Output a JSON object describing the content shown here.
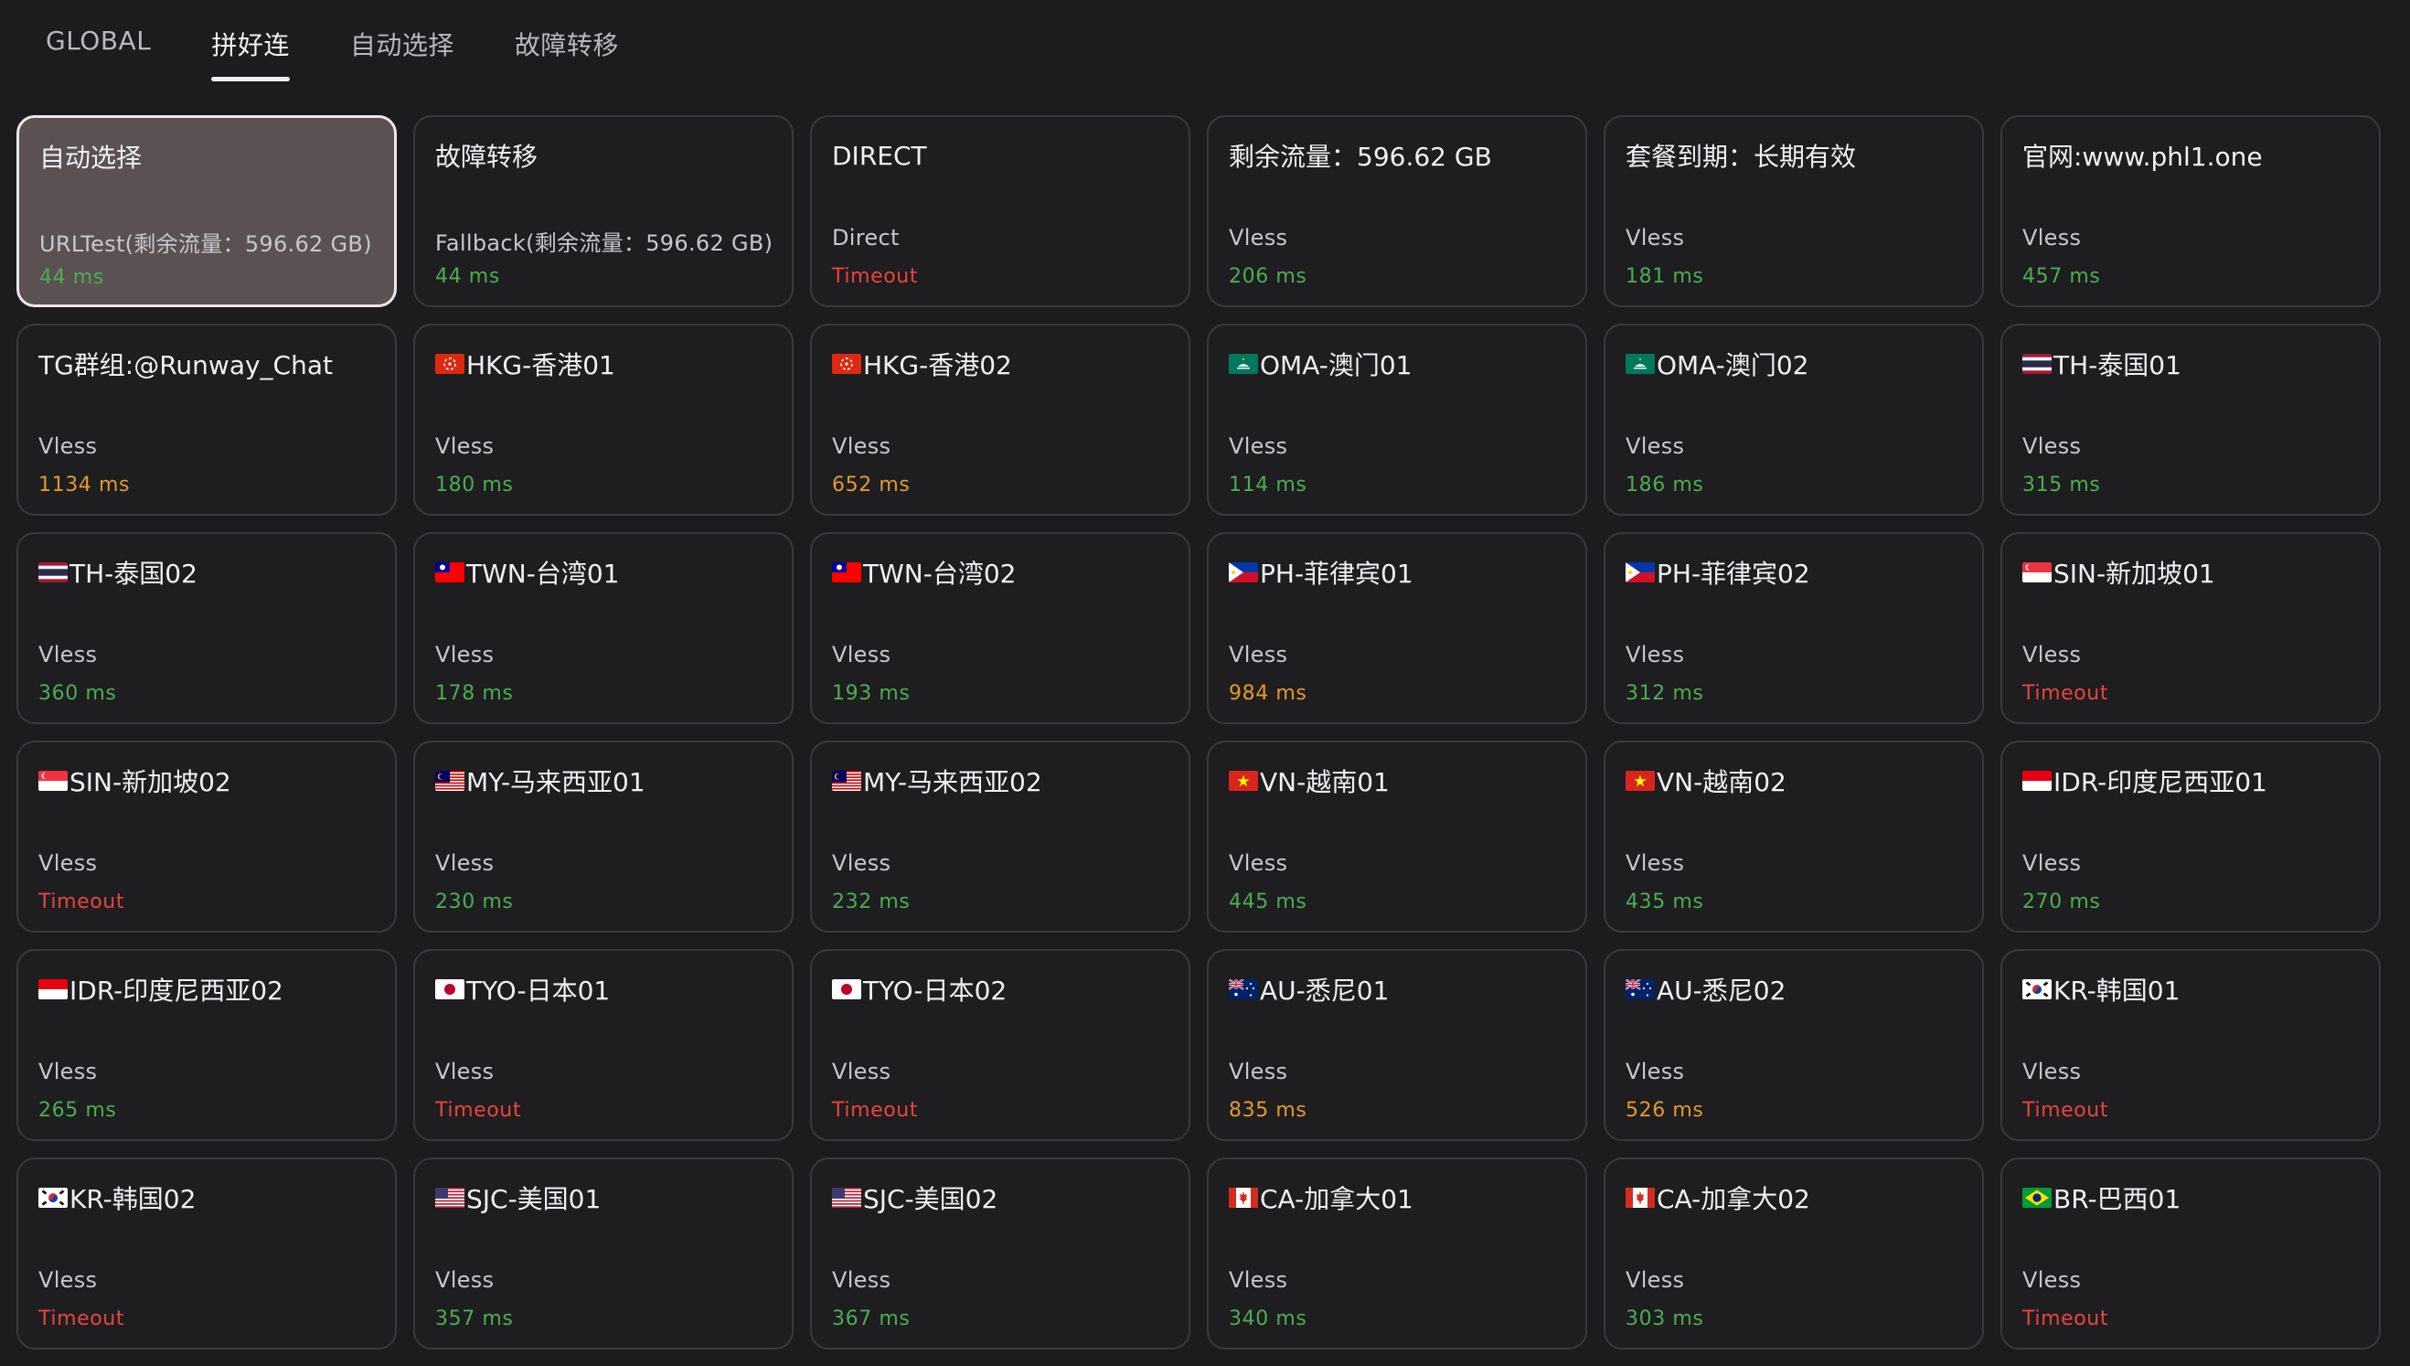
{
  "tabs": [
    {
      "label": "GLOBAL",
      "active": false
    },
    {
      "label": "拼好连",
      "active": true
    },
    {
      "label": "自动选择",
      "active": false
    },
    {
      "label": "故障转移",
      "active": false
    }
  ],
  "colors": {
    "good": "#4cae4f",
    "warn": "#e39a2b",
    "bad": "#e8453c"
  },
  "proxies": [
    {
      "name": "自动选择",
      "flag": "",
      "type": "URLTest(剩余流量：596.62 GB)",
      "delay": "44 ms",
      "status": "good",
      "selected": true
    },
    {
      "name": "故障转移",
      "flag": "",
      "type": "Fallback(剩余流量：596.62 GB)",
      "delay": "44 ms",
      "status": "good"
    },
    {
      "name": "DIRECT",
      "flag": "",
      "type": "Direct",
      "delay": "Timeout",
      "status": "bad"
    },
    {
      "name": "剩余流量：596.62 GB",
      "flag": "",
      "type": "Vless",
      "delay": "206 ms",
      "status": "good"
    },
    {
      "name": "套餐到期：长期有效",
      "flag": "",
      "type": "Vless",
      "delay": "181 ms",
      "status": "good"
    },
    {
      "name": "官网:www.phl1.one",
      "flag": "",
      "type": "Vless",
      "delay": "457 ms",
      "status": "good"
    },
    {
      "name": "TG群组:@Runway_Chat",
      "flag": "",
      "type": "Vless",
      "delay": "1134 ms",
      "status": "warn"
    },
    {
      "name": "HKG-香港01",
      "flag": "hk-flag-icon",
      "type": "Vless",
      "delay": "180 ms",
      "status": "good"
    },
    {
      "name": "HKG-香港02",
      "flag": "hk-flag-icon",
      "type": "Vless",
      "delay": "652 ms",
      "status": "warn"
    },
    {
      "name": "OMA-澳门01",
      "flag": "mo-flag-icon",
      "type": "Vless",
      "delay": "114 ms",
      "status": "good"
    },
    {
      "name": "OMA-澳门02",
      "flag": "mo-flag-icon",
      "type": "Vless",
      "delay": "186 ms",
      "status": "good"
    },
    {
      "name": "TH-泰国01",
      "flag": "th-flag-icon",
      "type": "Vless",
      "delay": "315 ms",
      "status": "good"
    },
    {
      "name": "TH-泰国02",
      "flag": "th-flag-icon",
      "type": "Vless",
      "delay": "360 ms",
      "status": "good"
    },
    {
      "name": "TWN-台湾01",
      "flag": "tw-flag-icon",
      "type": "Vless",
      "delay": "178 ms",
      "status": "good"
    },
    {
      "name": "TWN-台湾02",
      "flag": "tw-flag-icon",
      "type": "Vless",
      "delay": "193 ms",
      "status": "good"
    },
    {
      "name": "PH-菲律宾01",
      "flag": "ph-flag-icon",
      "type": "Vless",
      "delay": "984 ms",
      "status": "warn"
    },
    {
      "name": "PH-菲律宾02",
      "flag": "ph-flag-icon",
      "type": "Vless",
      "delay": "312 ms",
      "status": "good"
    },
    {
      "name": "SIN-新加坡01",
      "flag": "sg-flag-icon",
      "type": "Vless",
      "delay": "Timeout",
      "status": "bad"
    },
    {
      "name": "SIN-新加坡02",
      "flag": "sg-flag-icon",
      "type": "Vless",
      "delay": "Timeout",
      "status": "bad"
    },
    {
      "name": "MY-马来西亚01",
      "flag": "my-flag-icon",
      "type": "Vless",
      "delay": "230 ms",
      "status": "good"
    },
    {
      "name": "MY-马来西亚02",
      "flag": "my-flag-icon",
      "type": "Vless",
      "delay": "232 ms",
      "status": "good"
    },
    {
      "name": "VN-越南01",
      "flag": "vn-flag-icon",
      "type": "Vless",
      "delay": "445 ms",
      "status": "good"
    },
    {
      "name": "VN-越南02",
      "flag": "vn-flag-icon",
      "type": "Vless",
      "delay": "435 ms",
      "status": "good"
    },
    {
      "name": "IDR-印度尼西亚01",
      "flag": "id-flag-icon",
      "type": "Vless",
      "delay": "270 ms",
      "status": "good"
    },
    {
      "name": "IDR-印度尼西亚02",
      "flag": "id-flag-icon",
      "type": "Vless",
      "delay": "265 ms",
      "status": "good"
    },
    {
      "name": "TYO-日本01",
      "flag": "jp-flag-icon",
      "type": "Vless",
      "delay": "Timeout",
      "status": "bad"
    },
    {
      "name": "TYO-日本02",
      "flag": "jp-flag-icon",
      "type": "Vless",
      "delay": "Timeout",
      "status": "bad"
    },
    {
      "name": "AU-悉尼01",
      "flag": "au-flag-icon",
      "type": "Vless",
      "delay": "835 ms",
      "status": "warn"
    },
    {
      "name": "AU-悉尼02",
      "flag": "au-flag-icon",
      "type": "Vless",
      "delay": "526 ms",
      "status": "warn"
    },
    {
      "name": "KR-韩国01",
      "flag": "kr-flag-icon",
      "type": "Vless",
      "delay": "Timeout",
      "status": "bad"
    },
    {
      "name": "KR-韩国02",
      "flag": "kr-flag-icon",
      "type": "Vless",
      "delay": "Timeout",
      "status": "bad"
    },
    {
      "name": "SJC-美国01",
      "flag": "us-flag-icon",
      "type": "Vless",
      "delay": "357 ms",
      "status": "good"
    },
    {
      "name": "SJC-美国02",
      "flag": "us-flag-icon",
      "type": "Vless",
      "delay": "367 ms",
      "status": "good"
    },
    {
      "name": "CA-加拿大01",
      "flag": "ca-flag-icon",
      "type": "Vless",
      "delay": "340 ms",
      "status": "good"
    },
    {
      "name": "CA-加拿大02",
      "flag": "ca-flag-icon",
      "type": "Vless",
      "delay": "303 ms",
      "status": "good"
    },
    {
      "name": "BR-巴西01",
      "flag": "br-flag-icon",
      "type": "Vless",
      "delay": "Timeout",
      "status": "bad"
    }
  ]
}
